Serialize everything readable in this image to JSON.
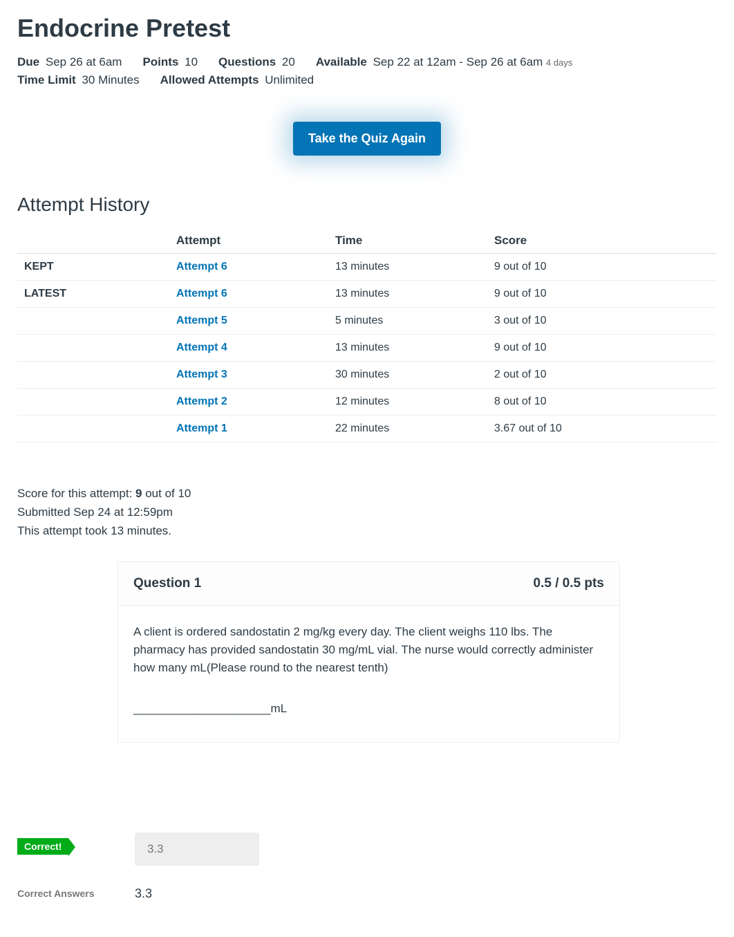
{
  "title": "Endocrine Pretest",
  "meta": {
    "due_label": "Due",
    "due_value": "Sep 26 at 6am",
    "points_label": "Points",
    "points_value": "10",
    "questions_label": "Questions",
    "questions_value": "20",
    "available_label": "Available",
    "available_value": "Sep 22 at 12am - Sep 26 at 6am",
    "available_duration": "4 days",
    "time_limit_label": "Time Limit",
    "time_limit_value": "30 Minutes",
    "allowed_attempts_label": "Allowed Attempts",
    "allowed_attempts_value": "Unlimited"
  },
  "take_quiz_label": "Take the Quiz Again",
  "history": {
    "heading": "Attempt History",
    "headers": {
      "status": "",
      "attempt": "Attempt",
      "time": "Time",
      "score": "Score"
    },
    "rows": [
      {
        "status": "KEPT",
        "attempt": "Attempt 6",
        "time": "13 minutes",
        "score": "9 out of 10"
      },
      {
        "status": "LATEST",
        "attempt": "Attempt 6",
        "time": "13 minutes",
        "score": "9 out of 10"
      },
      {
        "status": "",
        "attempt": "Attempt 5",
        "time": "5 minutes",
        "score": "3 out of 10"
      },
      {
        "status": "",
        "attempt": "Attempt 4",
        "time": "13 minutes",
        "score": "9 out of 10"
      },
      {
        "status": "",
        "attempt": "Attempt 3",
        "time": "30 minutes",
        "score": "2 out of 10"
      },
      {
        "status": "",
        "attempt": "Attempt 2",
        "time": "12 minutes",
        "score": "8 out of 10"
      },
      {
        "status": "",
        "attempt": "Attempt 1",
        "time": "22 minutes",
        "score": "3.67 out of 10"
      }
    ]
  },
  "summary": {
    "score_prefix": "Score for this attempt: ",
    "score_value": "9",
    "score_suffix": " out of 10",
    "submitted": "Submitted Sep 24 at 12:59pm",
    "duration": "This attempt took 13 minutes."
  },
  "question": {
    "label": "Question 1",
    "points": "0.5 / 0.5 pts",
    "text": "A client is ordered sandostatin 2 mg/kg every day. The client weighs 110 lbs. The pharmacy has provided sandostatin 30 mg/mL vial. The nurse would correctly administer how many mL(Please round to the nearest tenth)",
    "blank": "_____________________mL"
  },
  "answer": {
    "correct_label": "Correct!",
    "user_answer": "3.3",
    "correct_answers_label": "Correct Answers",
    "correct_answers_value": "3.3"
  }
}
